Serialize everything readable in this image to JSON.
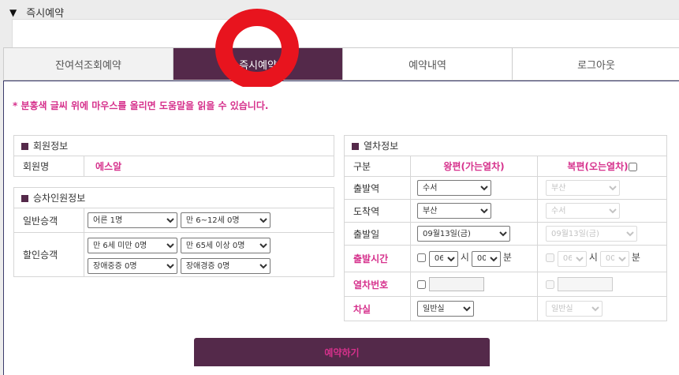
{
  "section_title": "즉시예약",
  "tabs": [
    "잔여석조회예약",
    "즉시예약",
    "예약내역",
    "로그아웃"
  ],
  "help_text": "* 분홍색 글씨 위에 마우스를 올리면 도움말을 읽을 수 있습니다.",
  "member": {
    "title": "회원정보",
    "name_label": "회원명",
    "name_value": "에스알"
  },
  "passengers": {
    "title": "승차인원정보",
    "general_label": "일반승객",
    "adult": "어른 1명",
    "child": "만 6~12세 0명",
    "discount_label": "할인승객",
    "infant": "만 6세 미만 0명",
    "senior": "만 65세 이상 0명",
    "disabled_severe": "장애중증 0명",
    "disabled_mild": "장애경증 0명"
  },
  "train": {
    "title": "열차정보",
    "col_type": "구분",
    "col_outbound": "왕편(가는열차)",
    "col_return": "복편(오는열차)",
    "depart_label": "출발역",
    "depart_out": "수서",
    "depart_ret": "부산",
    "arrive_label": "도착역",
    "arrive_out": "부산",
    "arrive_ret": "수서",
    "date_label": "출발일",
    "date_out": "09월13일(금)",
    "date_ret": "09월13일(금)",
    "time_label": "출발시간",
    "hour_out": "06",
    "min_out": "00",
    "hour_ret": "06",
    "min_ret": "00",
    "hour_unit": "시",
    "min_unit": "분",
    "trainno_label": "열차번호",
    "class_label": "차실",
    "class_out": "일반실",
    "class_ret": "일반실"
  },
  "reserve_button": "예약하기",
  "colors": {
    "accent": "#54294a",
    "pink": "#d6318c",
    "overlay_red": "#e8141e"
  }
}
